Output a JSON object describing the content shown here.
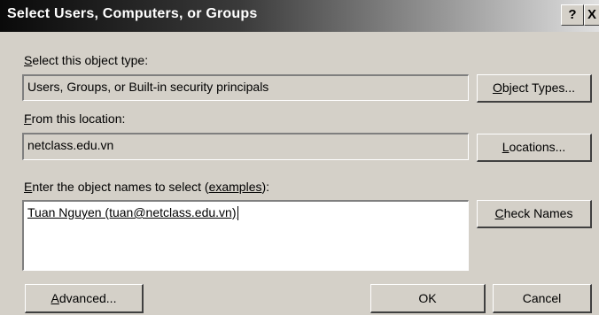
{
  "window": {
    "title": "Select Users, Computers, or Groups",
    "help_label": "?",
    "close_label": "X"
  },
  "object_type": {
    "label_accel": "S",
    "label_rest": "elect this object type:",
    "value": "Users, Groups, or Built-in security principals",
    "button_accel": "O",
    "button_rest": "bject Types..."
  },
  "location": {
    "label_accel": "F",
    "label_rest": "rom this location:",
    "value": "netclass.edu.vn",
    "button_accel": "L",
    "button_rest": "ocations..."
  },
  "names": {
    "label_accel": "E",
    "label_rest": "nter the object names to select (",
    "link": "examples",
    "label_end": "):",
    "value": "Tuan Nguyen (tuan@netclass.edu.vn)",
    "check_accel": "C",
    "check_rest": "heck Names"
  },
  "footer": {
    "advanced_accel": "A",
    "advanced_rest": "dvanced...",
    "ok_label": "OK",
    "cancel_label": "Cancel"
  }
}
